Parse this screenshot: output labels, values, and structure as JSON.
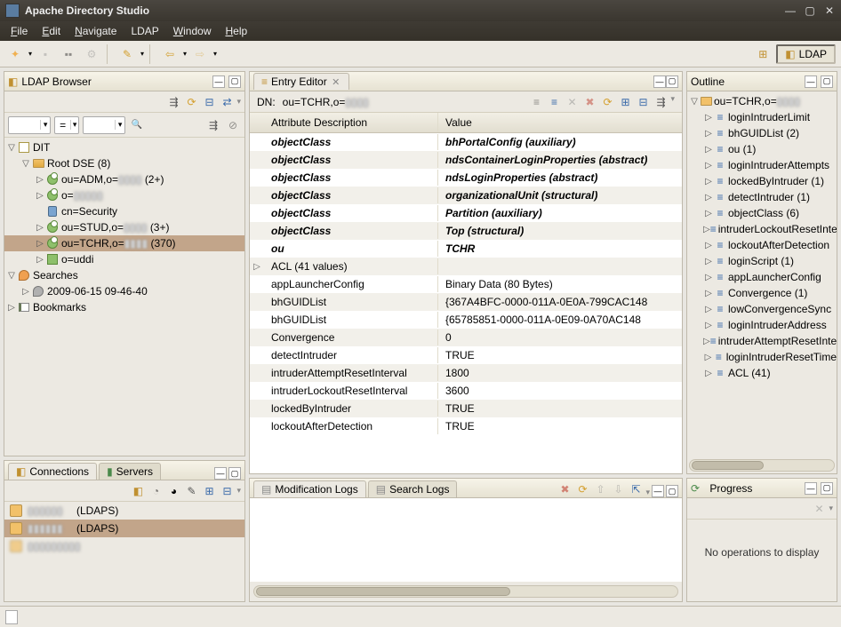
{
  "window": {
    "title": "Apache Directory Studio"
  },
  "menu": {
    "file": "File",
    "edit": "Edit",
    "navigate": "Navigate",
    "ldap": "LDAP",
    "window": "Window",
    "help": "Help"
  },
  "perspective": {
    "label": "LDAP"
  },
  "browser": {
    "title": "LDAP Browser",
    "filter_op": "=",
    "root": "DIT",
    "root_dse": "Root DSE (8)",
    "items": [
      {
        "label": "ou=ADM,o=",
        "suffix": "(2+)"
      },
      {
        "label": "o="
      },
      {
        "label": "cn=Security"
      },
      {
        "label": "ou=STUD,o=",
        "suffix": "(3+)"
      },
      {
        "label": "ou=TCHR,o=",
        "suffix": "(370)",
        "selected": true
      },
      {
        "label": "o=uddi"
      }
    ],
    "searches": "Searches",
    "search_name": "2009-06-15 09-46-40",
    "bookmarks": "Bookmarks"
  },
  "connections": {
    "tab1": "Connections",
    "tab2": "Servers",
    "rows": [
      {
        "label": "(LDAPS)"
      },
      {
        "label": "(LDAPS)",
        "selected": true
      },
      {
        "label": ""
      }
    ]
  },
  "entry": {
    "tab": "Entry Editor",
    "dn_label": "DN:",
    "dn_value": "ou=TCHR,o=",
    "col_attr": "Attribute Description",
    "col_val": "Value",
    "rows": [
      {
        "a": "objectClass",
        "v": "bhPortalConfig (auxiliary)",
        "b": true
      },
      {
        "a": "objectClass",
        "v": "ndsContainerLoginProperties (abstract)",
        "b": true,
        "trunc": true
      },
      {
        "a": "objectClass",
        "v": "ndsLoginProperties (abstract)",
        "b": true
      },
      {
        "a": "objectClass",
        "v": "organizationalUnit (structural)",
        "b": true
      },
      {
        "a": "objectClass",
        "v": "Partition (auxiliary)",
        "b": true
      },
      {
        "a": "objectClass",
        "v": "Top (structural)",
        "b": true
      },
      {
        "a": "ou",
        "v": "TCHR",
        "b": true
      },
      {
        "a": "ACL (41 values)",
        "v": "",
        "expand": true
      },
      {
        "a": "appLauncherConfig",
        "v": "Binary Data (80 Bytes)"
      },
      {
        "a": "bhGUIDList",
        "v": "{367A4BFC-0000-011A-0E0A-799CAC148"
      },
      {
        "a": "bhGUIDList",
        "v": "{65785851-0000-011A-0E09-0A70AC148"
      },
      {
        "a": "Convergence",
        "v": "0"
      },
      {
        "a": "detectIntruder",
        "v": "TRUE"
      },
      {
        "a": "intruderAttemptResetInterval",
        "v": "1800"
      },
      {
        "a": "intruderLockoutResetInterval",
        "v": "3600"
      },
      {
        "a": "lockedByIntruder",
        "v": "TRUE"
      },
      {
        "a": "lockoutAfterDetection",
        "v": "TRUE"
      }
    ]
  },
  "logs": {
    "tab1": "Modification Logs",
    "tab2": "Search Logs"
  },
  "outline": {
    "title": "Outline",
    "root": "ou=TCHR,o=",
    "items": [
      "loginIntruderLimit",
      "bhGUIDList (2)",
      "ou (1)",
      "loginIntruderAttempts",
      "lockedByIntruder (1)",
      "detectIntruder (1)",
      "objectClass (6)",
      "intruderLockoutResetInterval",
      "lockoutAfterDetection",
      "loginScript (1)",
      "appLauncherConfig",
      "Convergence (1)",
      "lowConvergenceSync",
      "loginIntruderAddress",
      "intruderAttemptResetInterval",
      "loginIntruderResetTime",
      "ACL (41)"
    ]
  },
  "progress": {
    "title": "Progress",
    "empty": "No operations to display"
  }
}
